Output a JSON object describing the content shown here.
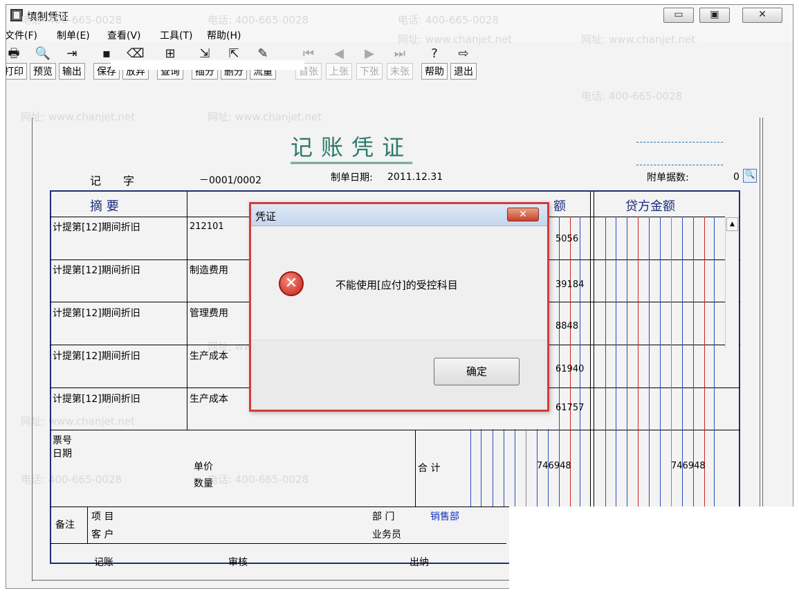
{
  "window": {
    "title": "填制凭证",
    "controls": {
      "minimize": "▭",
      "maximize": "▣",
      "close": "✕"
    }
  },
  "menu": [
    "文件(F)",
    "制单(E)",
    "查看(V)",
    "工具(T)",
    "帮助(H)"
  ],
  "toolbar": [
    {
      "label": "打印",
      "icon": "printer-icon",
      "glyph": "🖶",
      "enabled": true
    },
    {
      "label": "预览",
      "icon": "preview-icon",
      "glyph": "🔍",
      "enabled": true
    },
    {
      "label": "输出",
      "icon": "export-icon",
      "glyph": "⇥",
      "enabled": true
    },
    {
      "label": "保存",
      "icon": "save-icon",
      "glyph": "▪",
      "enabled": true
    },
    {
      "label": "放弃",
      "icon": "discard-icon",
      "glyph": "⌫",
      "enabled": true
    },
    {
      "label": "查询",
      "icon": "query-icon",
      "glyph": "⊞",
      "enabled": true
    },
    {
      "label": "插分",
      "icon": "insert-entry-icon",
      "glyph": "⇲",
      "enabled": true
    },
    {
      "label": "删分",
      "icon": "delete-entry-icon",
      "glyph": "⇱",
      "enabled": true
    },
    {
      "label": "流量",
      "icon": "cashflow-icon",
      "glyph": "✎",
      "enabled": true
    },
    {
      "label": "首张",
      "icon": "first-page-icon",
      "glyph": "⏮",
      "enabled": false
    },
    {
      "label": "上张",
      "icon": "prev-page-icon",
      "glyph": "◀",
      "enabled": false
    },
    {
      "label": "下张",
      "icon": "next-page-icon",
      "glyph": "▶",
      "enabled": false
    },
    {
      "label": "末张",
      "icon": "last-page-icon",
      "glyph": "⏭",
      "enabled": false
    },
    {
      "label": "帮助",
      "icon": "help-icon",
      "glyph": "?",
      "enabled": true
    },
    {
      "label": "退出",
      "icon": "exit-icon",
      "glyph": "⇨",
      "enabled": true
    }
  ],
  "watermark": {
    "phone": "电话: 400-665-0028",
    "web": "网址: www.chanjet.net"
  },
  "voucher": {
    "title": "记账凭证",
    "type_label": "记　　字",
    "number": "－0001/0002",
    "date_label": "制单日期:",
    "date": "2011.12.31",
    "attachments_label": "附单据数:",
    "attachments": "0",
    "headers": {
      "summary": "摘 要",
      "debit": "额",
      "credit": "贷方金额"
    },
    "rows": [
      {
        "summary": "计提第[12]期间折旧",
        "account": "212101",
        "debit": "5056"
      },
      {
        "summary": "计提第[12]期间折旧",
        "account": "制造费用",
        "debit": "39184"
      },
      {
        "summary": "计提第[12]期间折旧",
        "account": "管理费用",
        "debit": "8848"
      },
      {
        "summary": "计提第[12]期间折旧",
        "account": "生产成本",
        "debit": "61940"
      },
      {
        "summary": "计提第[12]期间折旧",
        "account": "生产成本",
        "debit": "61757"
      }
    ],
    "footer": {
      "ticket_label": "票号",
      "date_label": "日期",
      "price_label": "单价",
      "qty_label": "数量",
      "total_label": "合 计",
      "debit_total": "746948",
      "credit_total": "746948",
      "note_label": "备注",
      "item_label": "项 目",
      "customer_label": "客 户",
      "dept_label": "部 门",
      "dept_value": "销售部",
      "staff_label": "业务员",
      "bookkeeper_label": "记账",
      "reviewer_label": "审核",
      "cashier_label": "出纳"
    }
  },
  "dialog": {
    "title": "凭证",
    "close": "✕",
    "message": "不能使用[应付]的受控科目",
    "ok": "确定",
    "icon": "error-icon"
  },
  "colors": {
    "title_green": "#2b7a6a",
    "frame_blue": "#1b2e7a",
    "dialog_border": "#d63a3a",
    "dept_blue": "#1030c0"
  }
}
